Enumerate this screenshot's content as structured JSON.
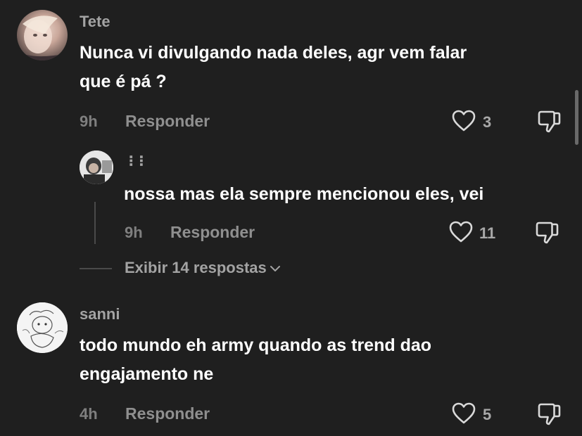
{
  "comments": [
    {
      "username": "Tete",
      "text_lines": [
        "Nunca vi divulgando nada deles, agr vem falar",
        "que é pá ?"
      ],
      "time": "9h",
      "reply_label": "Responder",
      "likes": "3"
    },
    {
      "username": "sanni",
      "text_lines": [
        "todo mundo eh army quando as trend dao",
        "engajamento ne"
      ],
      "time": "4h",
      "reply_label": "Responder",
      "likes": "5"
    }
  ],
  "reply": {
    "username": "⠸⠸",
    "text": "nossa mas ela sempre mencionou eles, vei",
    "time": "9h",
    "reply_label": "Responder",
    "likes": "11"
  },
  "expand_replies_label": "Exibir 14 respostas",
  "icons": {
    "like": "heart-outline-icon",
    "dislike": "thumbs-down-outline-icon",
    "expand": "chevron-down-icon"
  },
  "colors": {
    "background": "#1f1f1f",
    "text": "#ffffff",
    "muted": "#a3a3a3"
  }
}
